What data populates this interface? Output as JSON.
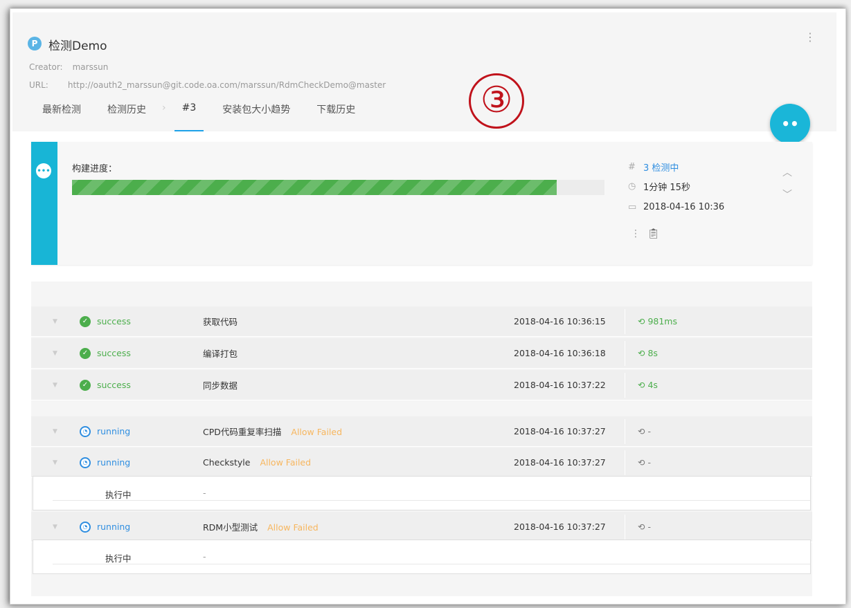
{
  "project": {
    "icon_letter": "P",
    "title": "检测Demo",
    "creator_label": "Creator:",
    "creator": "marssun",
    "url_label": "URL:",
    "url": "http://oauth2_marssun@git.code.oa.com/marssun/RdmCheckDemo@master"
  },
  "tabs": {
    "latest": "最新检测",
    "history": "检测历史",
    "build": "#3",
    "trend": "安装包大小趋势",
    "downloads": "下载历史"
  },
  "annotation": "③",
  "fab_label": "••",
  "build": {
    "progress_label": "构建进度：",
    "progress_percent": 91,
    "number_status": "3 检测中",
    "duration": "1分钟 15秒",
    "date": "2018-04-16 10:36"
  },
  "steps": [
    {
      "status": "success",
      "name": "获取代码",
      "allow": "",
      "time": "2018-04-16 10:36:15",
      "duration": "981ms"
    },
    {
      "status": "success",
      "name": "编译打包",
      "allow": "",
      "time": "2018-04-16 10:36:18",
      "duration": "8s"
    },
    {
      "status": "success",
      "name": "同步数据",
      "allow": "",
      "time": "2018-04-16 10:37:22",
      "duration": "4s"
    },
    {
      "status": "running",
      "name": "CPD代码重复率扫描",
      "allow": "Allow Failed",
      "time": "2018-04-16 10:37:27",
      "duration": "-"
    },
    {
      "status": "running",
      "name": "Checkstyle",
      "allow": "Allow Failed",
      "time": "2018-04-16 10:37:27",
      "duration": "-"
    },
    {
      "status": "running",
      "name": "RDM小型测试",
      "allow": "Allow Failed",
      "time": "2018-04-16 10:37:27",
      "duration": "-"
    }
  ],
  "step_details": [
    {
      "label": "执行中",
      "value": "-"
    },
    {
      "label": "执行中",
      "value": "-"
    }
  ],
  "colors": {
    "accent": "#1ab6d8",
    "success": "#4cae4c",
    "running": "#2f8ee0",
    "allow_failed": "#f7b65e",
    "annotation": "#c0121b"
  }
}
